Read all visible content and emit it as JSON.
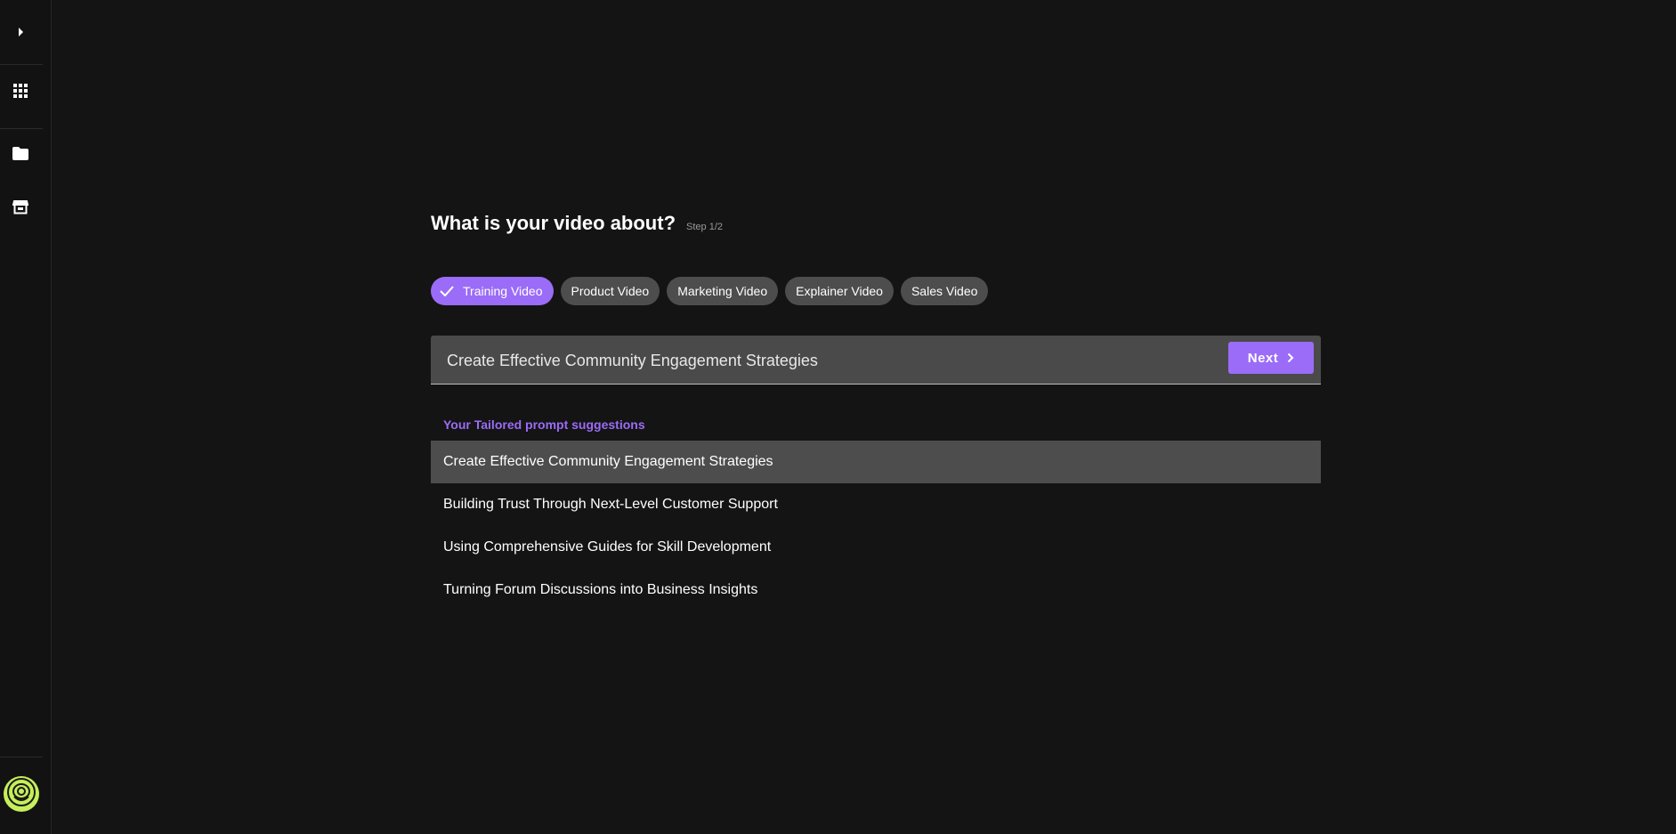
{
  "sidebar": {
    "icons": [
      "chevron-right-icon",
      "grid-icon",
      "folder-icon",
      "store-icon"
    ],
    "avatar_icon": "avatar-icon"
  },
  "main": {
    "title": "What is your video about?",
    "step": "Step 1/2",
    "chips": [
      {
        "label": "Training Video",
        "selected": true
      },
      {
        "label": "Product Video",
        "selected": false
      },
      {
        "label": "Marketing Video",
        "selected": false
      },
      {
        "label": "Explainer Video",
        "selected": false
      },
      {
        "label": "Sales Video",
        "selected": false
      }
    ],
    "prompt": {
      "value": "Create Effective Community Engagement Strategies"
    },
    "next_label": "Next",
    "suggestions_heading": "Your Tailored prompt suggestions",
    "suggestions": [
      "Create Effective Community Engagement Strategies",
      "Building Trust Through Next-Level Customer Support",
      "Using Comprehensive Guides for Skill Development",
      "Turning Forum Discussions into Business Insights"
    ]
  },
  "colors": {
    "accent": "#9b6cf7",
    "background": "#141414",
    "chip": "#4d4d4d",
    "avatar": "#c6ef5a"
  }
}
